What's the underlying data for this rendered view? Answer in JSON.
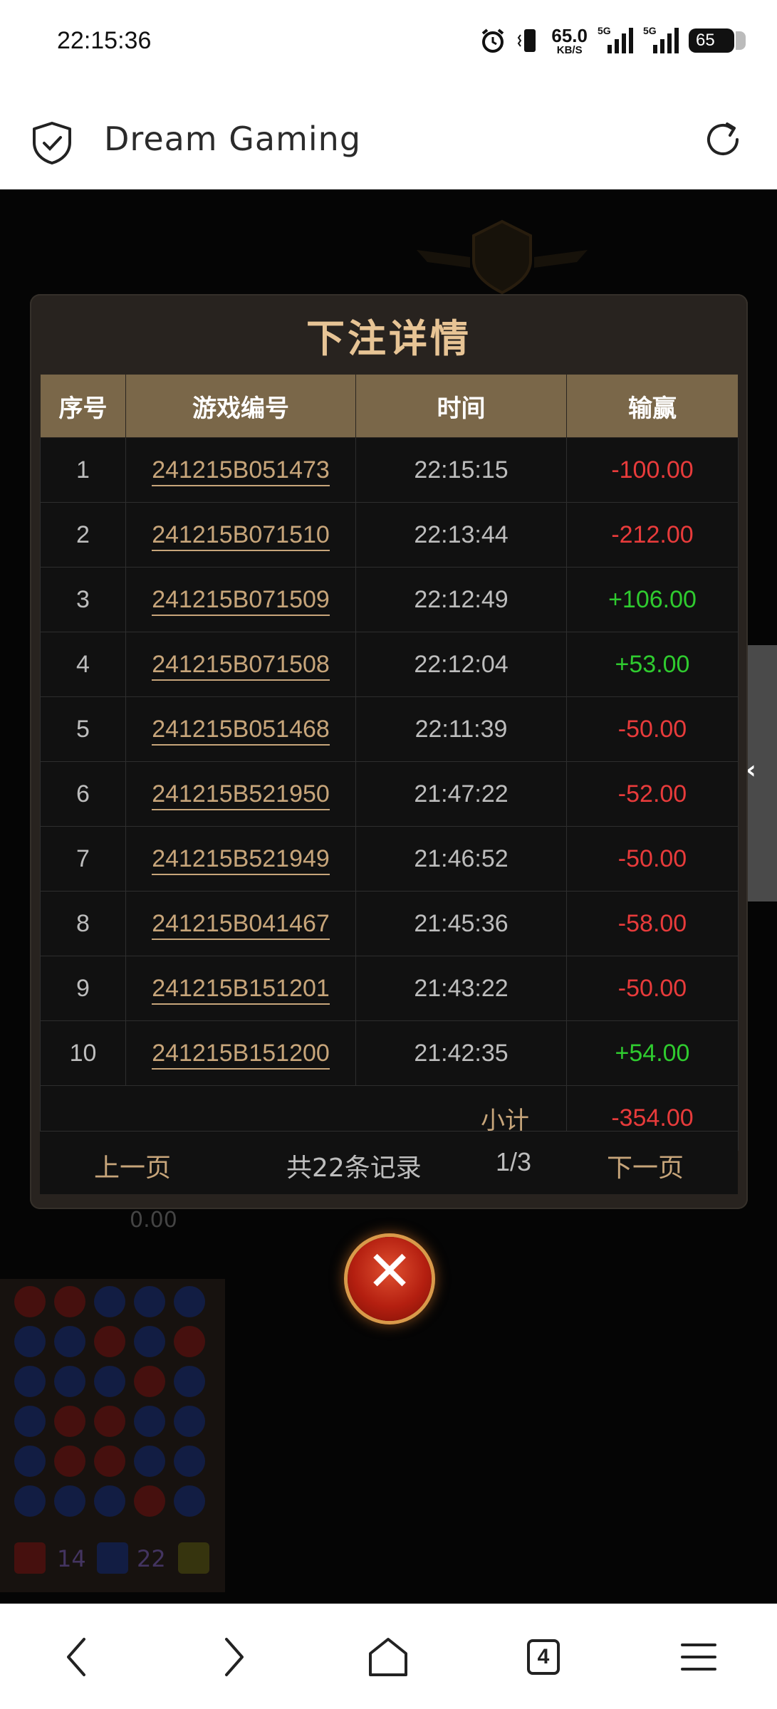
{
  "status_bar": {
    "time": "22:15:36",
    "net_speed": "65.0",
    "net_speed_unit": "KB/S",
    "signal_tag_1": "5G",
    "signal_tag_2": "5G",
    "battery": "65"
  },
  "app_bar": {
    "title": "Dream Gaming",
    "icons": [
      "shield-check-icon",
      "reload-icon"
    ]
  },
  "dialog": {
    "title": "下注详情",
    "columns": [
      "序号",
      "游戏编号",
      "时间",
      "输赢"
    ],
    "rows": [
      {
        "no": "1",
        "game_id": "241215B051473",
        "time": "22:15:15",
        "result": "-100.00"
      },
      {
        "no": "2",
        "game_id": "241215B071510",
        "time": "22:13:44",
        "result": "-212.00"
      },
      {
        "no": "3",
        "game_id": "241215B071509",
        "time": "22:12:49",
        "result": "+106.00"
      },
      {
        "no": "4",
        "game_id": "241215B071508",
        "time": "22:12:04",
        "result": "+53.00"
      },
      {
        "no": "5",
        "game_id": "241215B051468",
        "time": "22:11:39",
        "result": "-50.00"
      },
      {
        "no": "6",
        "game_id": "241215B521950",
        "time": "21:47:22",
        "result": "-52.00"
      },
      {
        "no": "7",
        "game_id": "241215B521949",
        "time": "21:46:52",
        "result": "-50.00"
      },
      {
        "no": "8",
        "game_id": "241215B041467",
        "time": "21:45:36",
        "result": "-58.00"
      },
      {
        "no": "9",
        "game_id": "241215B151201",
        "time": "21:43:22",
        "result": "-50.00"
      },
      {
        "no": "10",
        "game_id": "241215B151200",
        "time": "21:42:35",
        "result": "+54.00"
      }
    ],
    "subtotal_label": "小计",
    "subtotal_value": "-354.00",
    "pager": {
      "prev": "上一页",
      "total": "共22条记录",
      "page": "1/3",
      "next": "下一页"
    },
    "colors": {
      "loss": "#e83b3b",
      "win": "#2fcb2f",
      "accent": "#c7a57a"
    }
  },
  "background": {
    "scores": [
      "0.00",
      "14",
      "22"
    ]
  },
  "side_tab": {
    "glyph": "‹"
  },
  "close_button": {
    "glyph": "✕"
  },
  "nav_bar": {
    "tab_count": "4",
    "icons": [
      "back-icon",
      "forward-icon",
      "home-icon",
      "tabs-icon",
      "menu-icon"
    ]
  }
}
